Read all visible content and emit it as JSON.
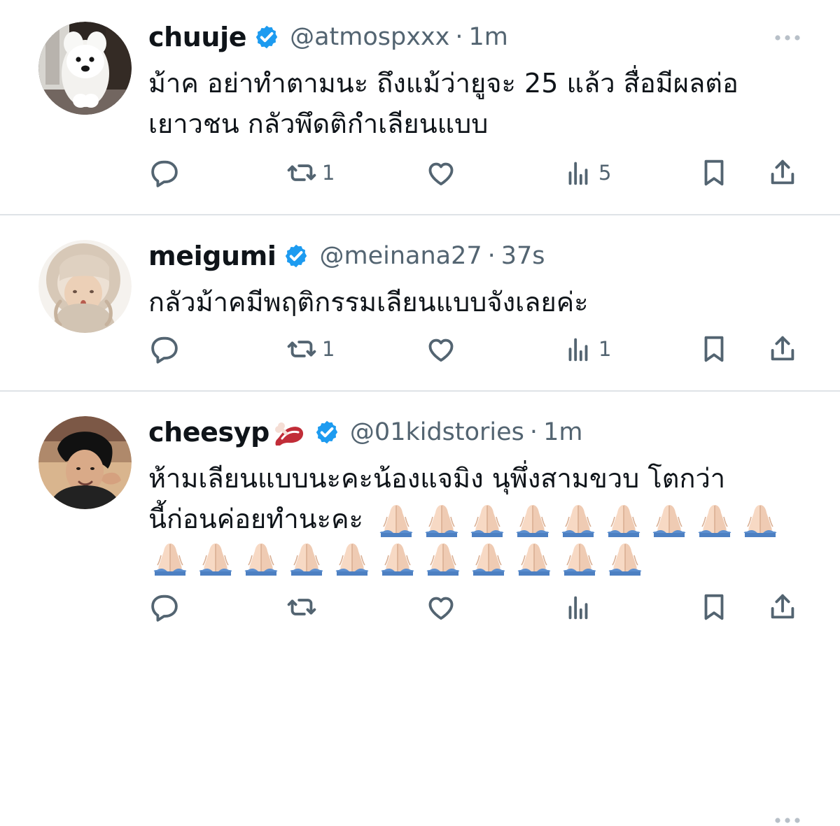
{
  "tweets": [
    {
      "display_name": "chuuje",
      "handle": "@atmospxxx",
      "separator": "·",
      "timestamp": "1m",
      "text_lines": [
        "ม้าค อย่าทำตามนะ ถึงแม้ว่ายูจะ 25 แล้ว สื่อมีผลต่อ",
        "เยาวชน กลัวพึดติกำเลียนแบบ"
      ],
      "reply_count": "",
      "retweet_count": "1",
      "like_count": "",
      "views_count": "5",
      "emojis_after_text": []
    },
    {
      "display_name": "meigumi",
      "handle": "@meinana27",
      "separator": "·",
      "timestamp": "37s",
      "text_lines": [
        "กลัวม้าคมีพฤติกรรมเลียนแบบจังเลยค่ะ"
      ],
      "reply_count": "",
      "retweet_count": "1",
      "like_count": "",
      "views_count": "1",
      "emojis_after_text": []
    },
    {
      "display_name": "cheesyp",
      "name_emoji": "meat-on-bone-icon",
      "handle": "@01kidstories",
      "separator": "·",
      "timestamp": "1m",
      "text_lines": [
        "ห้ามเลียนแบบนะคะน้องแจมิง นุพึ่งสามขวบ โตกว่า",
        "นี้ก่อนค่อยทำนะคะ"
      ],
      "reply_count": "",
      "retweet_count": "",
      "like_count": "",
      "views_count": "",
      "inline_pray_count": 9,
      "row_pray_count": 11,
      "emoji_name": "folded-hands-icon"
    }
  ],
  "ui": {
    "more_icon": "more-options-icon",
    "verified_icon": "verified-badge-icon",
    "reply_icon": "reply-icon",
    "retweet_icon": "retweet-icon",
    "like_icon": "heart-icon",
    "views_icon": "analytics-icon",
    "bookmark_icon": "bookmark-icon",
    "share_icon": "share-icon"
  },
  "colors": {
    "text_primary": "#0f1419",
    "text_secondary": "#536471",
    "verified_blue": "#1d9bf0",
    "divider": "#dfe3e7"
  }
}
